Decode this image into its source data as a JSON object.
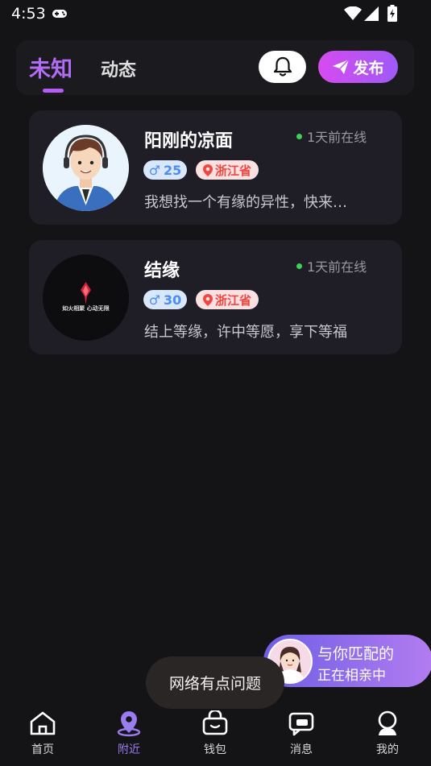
{
  "status_bar": {
    "time": "4:53"
  },
  "header": {
    "tabs": [
      {
        "label": "未知",
        "active": true
      },
      {
        "label": "动态",
        "active": false
      }
    ],
    "publish_label": "发布"
  },
  "cards": [
    {
      "name": "阳刚的凉面",
      "online": "1天前在线",
      "gender_symbol": "♂",
      "age": "25",
      "region": "浙江省",
      "bio": "我想找一个有缘的异性，快来…"
    },
    {
      "name": "结缘",
      "online": "1天前在线",
      "gender_symbol": "♂",
      "age": "30",
      "region": "浙江省",
      "bio": "结上等缘，许中等愿，享下等福",
      "avatar_text": "如火相聚 心动无限"
    }
  ],
  "match": {
    "title": "与你匹配的",
    "subtitle": "正在相亲中"
  },
  "toast": "网络有点问题",
  "nav": [
    {
      "label": "首页",
      "icon": "home-icon",
      "active": false
    },
    {
      "label": "附近",
      "icon": "location-icon",
      "active": true
    },
    {
      "label": "钱包",
      "icon": "wallet-icon",
      "active": false
    },
    {
      "label": "消息",
      "icon": "message-icon",
      "active": false
    },
    {
      "label": "我的",
      "icon": "profile-icon",
      "active": false
    }
  ],
  "colors": {
    "accent": "#b06cf2",
    "background": "#141316",
    "card": "#1f1d26",
    "online_dot": "#3dd15a",
    "gender_badge": "#4b8df3",
    "region_badge": "#f0463f"
  }
}
